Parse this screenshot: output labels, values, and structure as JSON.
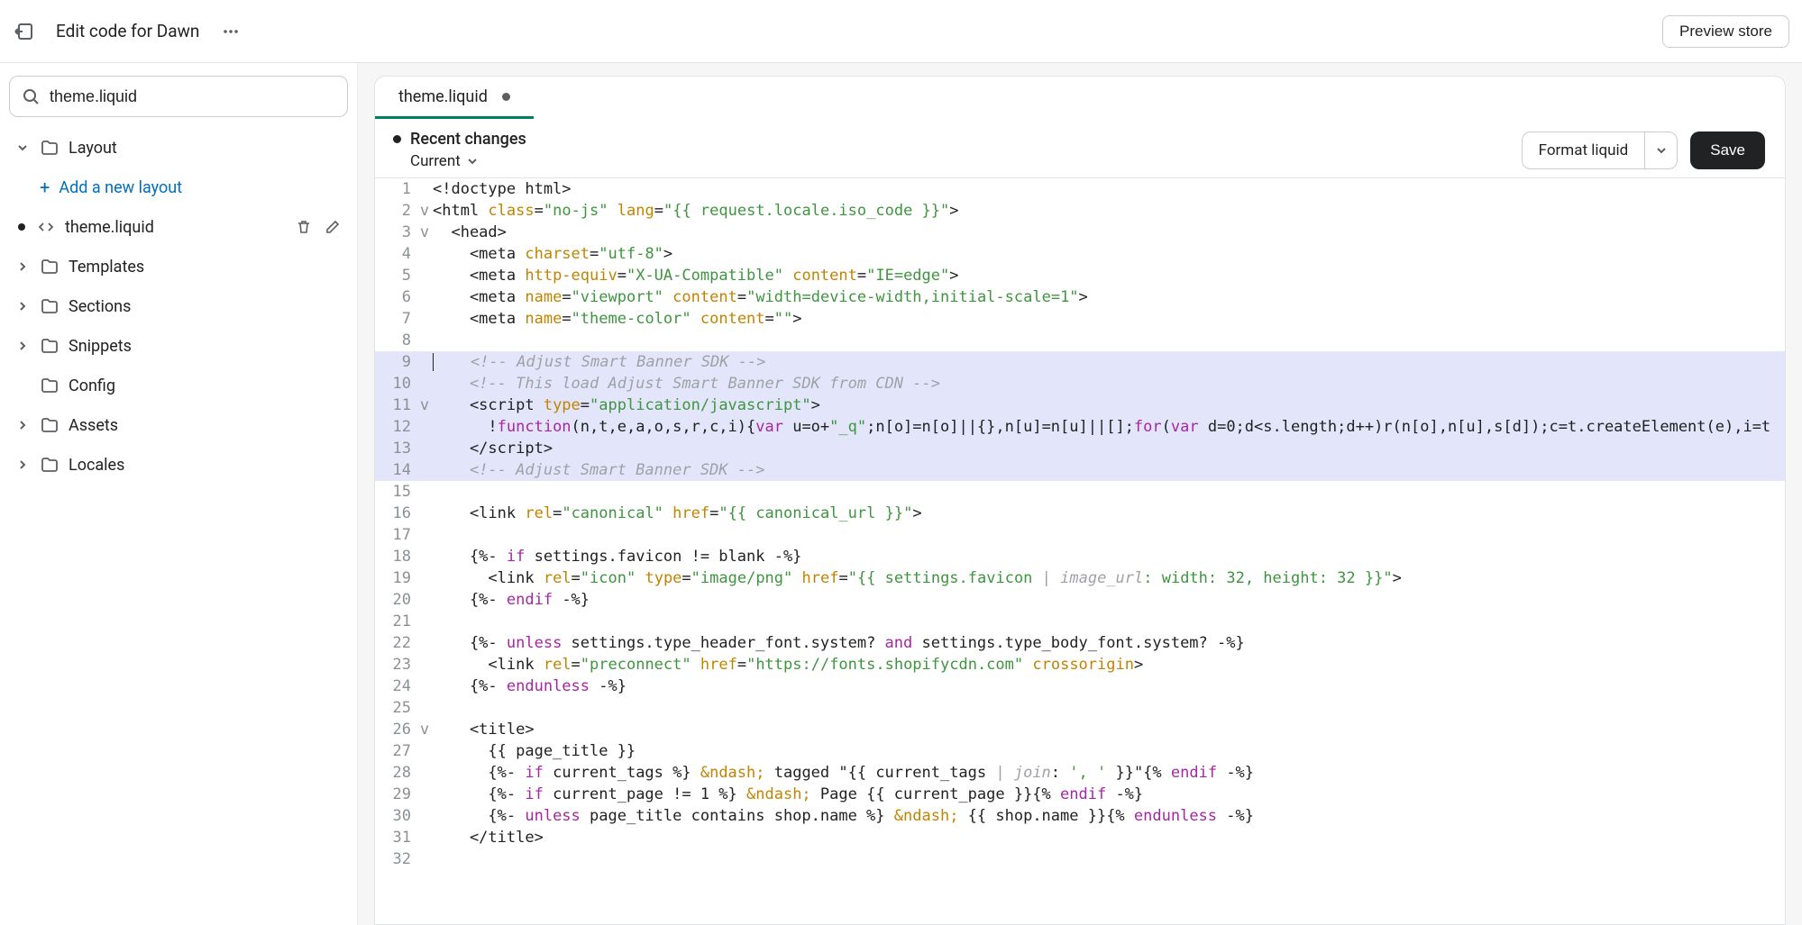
{
  "topbar": {
    "title": "Edit code for Dawn",
    "preview_label": "Preview store"
  },
  "sidebar": {
    "search_value": "theme.liquid",
    "group_layout": "Layout",
    "add_layout": "Add a new layout",
    "file_active": "theme.liquid",
    "group_templates": "Templates",
    "group_sections": "Sections",
    "group_snippets": "Snippets",
    "group_config": "Config",
    "group_assets": "Assets",
    "group_locales": "Locales"
  },
  "tabs": {
    "active": "theme.liquid"
  },
  "toolbar": {
    "recent_label": "Recent changes",
    "version": "Current",
    "format_label": "Format liquid",
    "save_label": "Save"
  },
  "code_meta": {
    "highlighted_lines": [
      9,
      10,
      11,
      12,
      13,
      14
    ],
    "fold_markers": {
      "2": "v",
      "3": "v",
      "11": "v",
      "26": "v"
    }
  },
  "code_lines": [
    {
      "n": 1,
      "seg": [
        [
          "",
          "<!doctype html>"
        ]
      ]
    },
    {
      "n": 2,
      "seg": [
        [
          "",
          "<html "
        ],
        [
          "attr",
          "class"
        ],
        [
          "",
          "="
        ],
        [
          "str",
          "\"no-js\""
        ],
        [
          "",
          " "
        ],
        [
          "attr",
          "lang"
        ],
        [
          "",
          "="
        ],
        [
          "str",
          "\"{{ request.locale.iso_code }}\""
        ],
        [
          "",
          ">"
        ]
      ]
    },
    {
      "n": 3,
      "seg": [
        [
          "",
          "  <head>"
        ]
      ]
    },
    {
      "n": 4,
      "seg": [
        [
          "",
          "    <meta "
        ],
        [
          "attr",
          "charset"
        ],
        [
          "",
          "="
        ],
        [
          "str",
          "\"utf-8\""
        ],
        [
          "",
          ">"
        ]
      ]
    },
    {
      "n": 5,
      "seg": [
        [
          "",
          "    <meta "
        ],
        [
          "attr",
          "http-equiv"
        ],
        [
          "",
          "="
        ],
        [
          "str",
          "\"X-UA-Compatible\""
        ],
        [
          "",
          " "
        ],
        [
          "attr",
          "content"
        ],
        [
          "",
          "="
        ],
        [
          "str",
          "\"IE=edge\""
        ],
        [
          "",
          ">"
        ]
      ]
    },
    {
      "n": 6,
      "seg": [
        [
          "",
          "    <meta "
        ],
        [
          "attr",
          "name"
        ],
        [
          "",
          "="
        ],
        [
          "str",
          "\"viewport\""
        ],
        [
          "",
          " "
        ],
        [
          "attr",
          "content"
        ],
        [
          "",
          "="
        ],
        [
          "str",
          "\"width=device-width,initial-scale=1\""
        ],
        [
          "",
          ">"
        ]
      ]
    },
    {
      "n": 7,
      "seg": [
        [
          "",
          "    <meta "
        ],
        [
          "attr",
          "name"
        ],
        [
          "",
          "="
        ],
        [
          "str",
          "\"theme-color\""
        ],
        [
          "",
          " "
        ],
        [
          "attr",
          "content"
        ],
        [
          "",
          "="
        ],
        [
          "str",
          "\"\""
        ],
        [
          "",
          ">"
        ]
      ]
    },
    {
      "n": 8,
      "seg": [
        [
          "",
          ""
        ]
      ]
    },
    {
      "n": 9,
      "seg": [
        [
          "cur",
          ""
        ],
        [
          "",
          "    "
        ],
        [
          "cmnt",
          "<!-- Adjust Smart Banner SDK -->"
        ]
      ]
    },
    {
      "n": 10,
      "seg": [
        [
          "",
          "    "
        ],
        [
          "cmnt",
          "<!-- This load Adjust Smart Banner SDK from CDN -->"
        ]
      ]
    },
    {
      "n": 11,
      "seg": [
        [
          "",
          "    <script "
        ],
        [
          "attr",
          "type"
        ],
        [
          "",
          "="
        ],
        [
          "str",
          "\"application/javascript\""
        ],
        [
          "",
          ">"
        ]
      ]
    },
    {
      "n": 12,
      "seg": [
        [
          "",
          "      !"
        ],
        [
          "kw",
          "function"
        ],
        [
          "",
          "(n,t,e,a,o,s,r,c,i){"
        ],
        [
          "kw",
          "var"
        ],
        [
          "",
          " u=o+"
        ],
        [
          "str",
          "\"_q\""
        ],
        [
          "",
          ";n[o]=n[o]||{},n[u]=n[u]||[];"
        ],
        [
          "kw",
          "for"
        ],
        [
          "",
          "("
        ],
        [
          "kw",
          "var"
        ],
        [
          "",
          " d=0;d<s.length;d++)r(n[o],n[u],s[d]);c=t.createElement(e),i=t"
        ]
      ]
    },
    {
      "n": 13,
      "seg": [
        [
          "",
          "    </script>"
        ]
      ]
    },
    {
      "n": 14,
      "seg": [
        [
          "",
          "    "
        ],
        [
          "cmnt",
          "<!-- Adjust Smart Banner SDK -->"
        ]
      ]
    },
    {
      "n": 15,
      "seg": [
        [
          "",
          ""
        ]
      ]
    },
    {
      "n": 16,
      "seg": [
        [
          "",
          "    <link "
        ],
        [
          "attr",
          "rel"
        ],
        [
          "",
          "="
        ],
        [
          "str",
          "\"canonical\""
        ],
        [
          "",
          " "
        ],
        [
          "attr",
          "href"
        ],
        [
          "",
          "="
        ],
        [
          "str",
          "\"{{ canonical_url }}\""
        ],
        [
          "",
          ">"
        ]
      ]
    },
    {
      "n": 17,
      "seg": [
        [
          "",
          ""
        ]
      ]
    },
    {
      "n": 18,
      "seg": [
        [
          "",
          "    {%- "
        ],
        [
          "kw",
          "if"
        ],
        [
          "",
          " settings.favicon != blank -%}"
        ]
      ]
    },
    {
      "n": 19,
      "seg": [
        [
          "",
          "      <link "
        ],
        [
          "attr",
          "rel"
        ],
        [
          "",
          "="
        ],
        [
          "str",
          "\"icon\""
        ],
        [
          "",
          " "
        ],
        [
          "attr",
          "type"
        ],
        [
          "",
          "="
        ],
        [
          "str",
          "\"image/png\""
        ],
        [
          "",
          " "
        ],
        [
          "attr",
          "href"
        ],
        [
          "",
          "="
        ],
        [
          "str",
          "\"{{ settings.favicon "
        ],
        [
          "filt",
          "| image_url"
        ],
        [
          "str",
          ": width: 32, height: 32 }}\""
        ],
        [
          "",
          ">"
        ]
      ]
    },
    {
      "n": 20,
      "seg": [
        [
          "",
          "    {%- "
        ],
        [
          "kw",
          "endif"
        ],
        [
          "",
          " -%}"
        ]
      ]
    },
    {
      "n": 21,
      "seg": [
        [
          "",
          ""
        ]
      ]
    },
    {
      "n": 22,
      "seg": [
        [
          "",
          "    {%- "
        ],
        [
          "kw",
          "unless"
        ],
        [
          "",
          " settings.type_header_font.system? "
        ],
        [
          "kw",
          "and"
        ],
        [
          "",
          " settings.type_body_font.system? -%}"
        ]
      ]
    },
    {
      "n": 23,
      "seg": [
        [
          "",
          "      <link "
        ],
        [
          "attr",
          "rel"
        ],
        [
          "",
          "="
        ],
        [
          "str",
          "\"preconnect\""
        ],
        [
          "",
          " "
        ],
        [
          "attr",
          "href"
        ],
        [
          "",
          "="
        ],
        [
          "str",
          "\"https://fonts.shopifycdn.com\""
        ],
        [
          "",
          " "
        ],
        [
          "attr",
          "crossorigin"
        ],
        [
          "",
          ">"
        ]
      ]
    },
    {
      "n": 24,
      "seg": [
        [
          "",
          "    {%- "
        ],
        [
          "kw",
          "endunless"
        ],
        [
          "",
          " -%}"
        ]
      ]
    },
    {
      "n": 25,
      "seg": [
        [
          "",
          ""
        ]
      ]
    },
    {
      "n": 26,
      "seg": [
        [
          "",
          "    <title>"
        ]
      ]
    },
    {
      "n": 27,
      "seg": [
        [
          "",
          "      {{ page_title }}"
        ]
      ]
    },
    {
      "n": 28,
      "seg": [
        [
          "",
          "      {%- "
        ],
        [
          "kw",
          "if"
        ],
        [
          "",
          " current_tags %} "
        ],
        [
          "ent",
          "&ndash;"
        ],
        [
          "",
          " tagged \"{{ current_tags "
        ],
        [
          "filt",
          "| join"
        ],
        [
          "",
          ": "
        ],
        [
          "str",
          "', '"
        ],
        [
          "",
          " }}\"{% "
        ],
        [
          "kw",
          "endif"
        ],
        [
          "",
          " -%}"
        ]
      ]
    },
    {
      "n": 29,
      "seg": [
        [
          "",
          "      {%- "
        ],
        [
          "kw",
          "if"
        ],
        [
          "",
          " current_page != 1 %} "
        ],
        [
          "ent",
          "&ndash;"
        ],
        [
          "",
          " Page {{ current_page }}{% "
        ],
        [
          "kw",
          "endif"
        ],
        [
          "",
          " -%}"
        ]
      ]
    },
    {
      "n": 30,
      "seg": [
        [
          "",
          "      {%- "
        ],
        [
          "kw",
          "unless"
        ],
        [
          "",
          " page_title contains shop.name %} "
        ],
        [
          "ent",
          "&ndash;"
        ],
        [
          "",
          " {{ shop.name }}{% "
        ],
        [
          "kw",
          "endunless"
        ],
        [
          "",
          " -%}"
        ]
      ]
    },
    {
      "n": 31,
      "seg": [
        [
          "",
          "    </title>"
        ]
      ]
    },
    {
      "n": 32,
      "seg": [
        [
          "",
          ""
        ]
      ]
    }
  ]
}
